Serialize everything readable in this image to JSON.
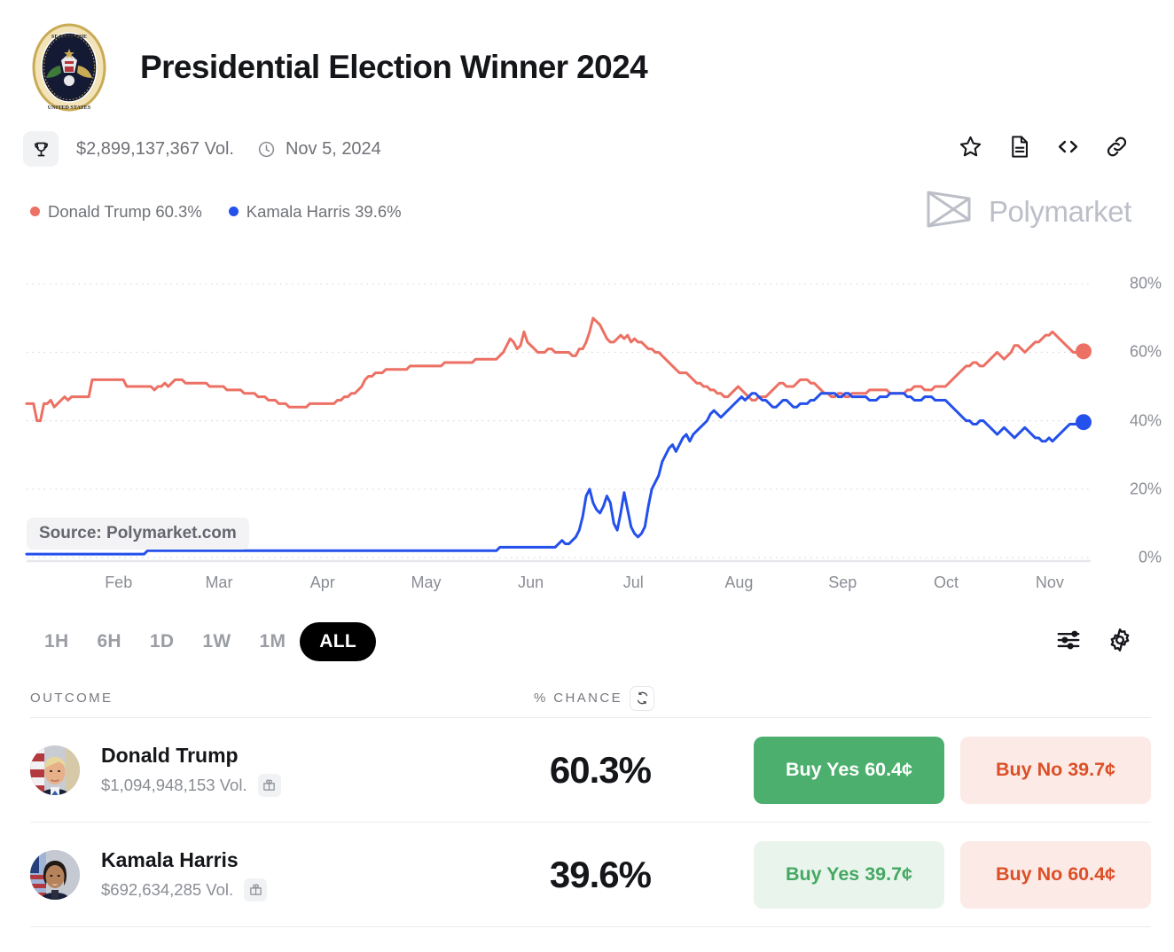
{
  "header": {
    "title": "Presidential Election Winner 2024",
    "seal_icon": "presidential-seal-icon"
  },
  "meta": {
    "trophy_icon": "trophy-icon",
    "volume": "$2,899,137,367 Vol.",
    "clock_icon": "clock-icon",
    "date": "Nov 5, 2024",
    "actions": [
      {
        "name": "bookmark-star-icon",
        "label": "Bookmark"
      },
      {
        "name": "rules-document-icon",
        "label": "Rules"
      },
      {
        "name": "embed-code-icon",
        "label": "Embed"
      },
      {
        "name": "copy-link-icon",
        "label": "Copy link"
      }
    ]
  },
  "legend": [
    {
      "label": "Donald Trump 60.3%",
      "color": "#ec7063"
    },
    {
      "label": "Kamala Harris 39.6%",
      "color": "#2450eb"
    }
  ],
  "brand": {
    "name": "Polymarket",
    "logo_icon": "polymarket-logo-icon",
    "color": "#bcbfc7"
  },
  "chart_watermark": "Source: Polymarket.com",
  "ranges": [
    {
      "label": "1H",
      "active": false
    },
    {
      "label": "6H",
      "active": false
    },
    {
      "label": "1D",
      "active": false
    },
    {
      "label": "1W",
      "active": false
    },
    {
      "label": "1M",
      "active": false
    },
    {
      "label": "ALL",
      "active": true
    }
  ],
  "chart_tools": [
    {
      "name": "chart-filters-icon"
    },
    {
      "name": "chart-settings-gear-icon"
    }
  ],
  "table": {
    "col_outcome": "OUTCOME",
    "col_chance": "% CHANCE",
    "refresh_icon": "refresh-swap-icon",
    "rows": [
      {
        "avatar": "donald-trump-avatar",
        "name": "Donald Trump",
        "volume": "$1,094,948,153 Vol.",
        "gift_icon": "gift-icon",
        "chance": "60.3%",
        "yes_label": "Buy Yes 60.4¢",
        "no_label": "Buy No 39.7¢",
        "yes_style": "solid"
      },
      {
        "avatar": "kamala-harris-avatar",
        "name": "Kamala Harris",
        "volume": "$692,634,285 Vol.",
        "gift_icon": "gift-icon",
        "chance": "39.6%",
        "yes_label": "Buy Yes 39.7¢",
        "no_label": "Buy No 60.4¢",
        "yes_style": "soft"
      }
    ]
  },
  "chart_data": {
    "type": "line",
    "title": "Presidential Election Winner 2024",
    "xlabel": "",
    "ylabel": "% Chance",
    "ylim": [
      0,
      85
    ],
    "yticks": [
      0,
      20,
      40,
      60,
      80
    ],
    "ytick_labels": [
      "0%",
      "20%",
      "40%",
      "60%",
      "80%"
    ],
    "grid": true,
    "legend_position": "top-left",
    "xtick_labels": [
      "Feb",
      "Mar",
      "Apr",
      "May",
      "Jun",
      "Jul",
      "Aug",
      "Sep",
      "Oct",
      "Nov"
    ],
    "xtick_positions": [
      0.087,
      0.182,
      0.28,
      0.378,
      0.477,
      0.574,
      0.674,
      0.772,
      0.87,
      0.968
    ],
    "endpoint_labels": {
      "trump": "60.3%",
      "harris": "39.6%"
    },
    "series": [
      {
        "name": "Donald Trump",
        "color": "#ec7063",
        "end_value": 60.3,
        "values": [
          45,
          45,
          45,
          40,
          40,
          45,
          45,
          46,
          44,
          45,
          46,
          47,
          46,
          47,
          47,
          47,
          47,
          47,
          47,
          52,
          52,
          52,
          52,
          52,
          52,
          52,
          52,
          52,
          52,
          50,
          50,
          50,
          50,
          50,
          50,
          50,
          50,
          49,
          50,
          50,
          51,
          50,
          51,
          52,
          52,
          52,
          51,
          51,
          51,
          51,
          51,
          51,
          51,
          50,
          50,
          50,
          50,
          50,
          49,
          49,
          49,
          49,
          49,
          48,
          48,
          48,
          48,
          47,
          47,
          47,
          46,
          46,
          46,
          45,
          45,
          45,
          44,
          44,
          44,
          44,
          44,
          44,
          45,
          45,
          45,
          45,
          45,
          45,
          45,
          45,
          46,
          46,
          47,
          47,
          48,
          48,
          49,
          50,
          52,
          53,
          53,
          54,
          54,
          54,
          55,
          55,
          55,
          55,
          55,
          55,
          55,
          56,
          56,
          56,
          56,
          56,
          56,
          56,
          56,
          56,
          56,
          57,
          57,
          57,
          57,
          57,
          57,
          57,
          57,
          57,
          58,
          58,
          58,
          58,
          58,
          58,
          58,
          59,
          60,
          62,
          64,
          63,
          61,
          62,
          66,
          63,
          62,
          61,
          60,
          60,
          60,
          61,
          61,
          60,
          60,
          60,
          60,
          60,
          59,
          59,
          61,
          61,
          63,
          66,
          70,
          69,
          68,
          66,
          64,
          63,
          63,
          64,
          65,
          64,
          65,
          63,
          64,
          63,
          63,
          62,
          61,
          61,
          60,
          60,
          59,
          58,
          57,
          56,
          55,
          54,
          54,
          54,
          53,
          52,
          51,
          51,
          50,
          50,
          49,
          49,
          48,
          48,
          47,
          47,
          48,
          49,
          50,
          49,
          48,
          47,
          46,
          46,
          47,
          47,
          47,
          48,
          49,
          50,
          51,
          51,
          50,
          50,
          50,
          51,
          52,
          52,
          52,
          51,
          51,
          50,
          49,
          48,
          48,
          47,
          47,
          48,
          48,
          47,
          47,
          48,
          48,
          48,
          48,
          48,
          49,
          49,
          49,
          49,
          49,
          49,
          48,
          48,
          48,
          48,
          48,
          49,
          49,
          50,
          50,
          50,
          49,
          49,
          49,
          50,
          50,
          50,
          50,
          51,
          52,
          53,
          54,
          55,
          56,
          56,
          57,
          57,
          56,
          56,
          57,
          58,
          59,
          60,
          59,
          58,
          59,
          60,
          62,
          62,
          61,
          60,
          61,
          62,
          63,
          63,
          64,
          65,
          65,
          66,
          65,
          64,
          63,
          62,
          61,
          60,
          60,
          60,
          60
        ]
      },
      {
        "name": "Kamala Harris",
        "color": "#2450eb",
        "end_value": 39.6,
        "values": [
          1,
          1,
          1,
          1,
          1,
          1,
          1,
          1,
          1,
          1,
          1,
          1,
          1,
          1,
          1,
          1,
          1,
          1,
          1,
          1,
          1,
          1,
          1,
          1,
          1,
          1,
          1,
          1,
          1,
          1,
          1,
          1,
          1,
          1,
          1,
          2,
          2,
          2,
          2,
          2,
          2,
          2,
          2,
          2,
          2,
          2,
          2,
          2,
          2,
          2,
          2,
          2,
          2,
          2,
          2,
          2,
          2,
          2,
          2,
          2,
          2,
          2,
          2,
          2,
          2,
          2,
          2,
          2,
          2,
          2,
          2,
          2,
          2,
          2,
          2,
          2,
          2,
          2,
          2,
          2,
          2,
          2,
          2,
          2,
          2,
          2,
          2,
          2,
          2,
          2,
          2,
          2,
          2,
          2,
          2,
          2,
          2,
          2,
          2,
          2,
          2,
          2,
          2,
          2,
          2,
          2,
          2,
          2,
          2,
          2,
          2,
          2,
          2,
          2,
          2,
          2,
          2,
          2,
          2,
          2,
          2,
          2,
          2,
          2,
          2,
          2,
          2,
          2,
          2,
          2,
          2,
          2,
          2,
          2,
          2,
          2,
          2,
          3,
          3,
          3,
          3,
          3,
          3,
          3,
          3,
          3,
          3,
          3,
          3,
          3,
          3,
          3,
          3,
          3,
          4,
          5,
          4,
          4,
          5,
          6,
          8,
          12,
          18,
          20,
          16,
          14,
          13,
          15,
          18,
          16,
          10,
          8,
          13,
          19,
          14,
          9,
          7,
          6,
          7,
          9,
          15,
          20,
          22,
          24,
          28,
          30,
          32,
          33,
          31,
          33,
          35,
          36,
          34,
          36,
          37,
          38,
          39,
          40,
          42,
          43,
          42,
          41,
          42,
          43,
          44,
          45,
          46,
          47,
          46,
          47,
          48,
          48,
          47,
          46,
          46,
          45,
          44,
          44,
          45,
          46,
          46,
          45,
          44,
          44,
          45,
          45,
          45,
          46,
          46,
          47,
          48,
          48,
          48,
          48,
          48,
          47,
          47,
          48,
          48,
          47,
          47,
          47,
          47,
          47,
          46,
          46,
          46,
          47,
          47,
          47,
          48,
          48,
          48,
          48,
          48,
          47,
          47,
          46,
          46,
          46,
          47,
          47,
          47,
          46,
          46,
          46,
          46,
          45,
          44,
          43,
          42,
          41,
          40,
          40,
          39,
          39,
          40,
          40,
          39,
          38,
          37,
          36,
          37,
          38,
          37,
          36,
          35,
          36,
          37,
          38,
          37,
          36,
          35,
          35,
          34,
          34,
          35,
          34,
          35,
          36,
          37,
          38,
          39,
          39,
          39,
          39,
          40
        ]
      }
    ]
  }
}
